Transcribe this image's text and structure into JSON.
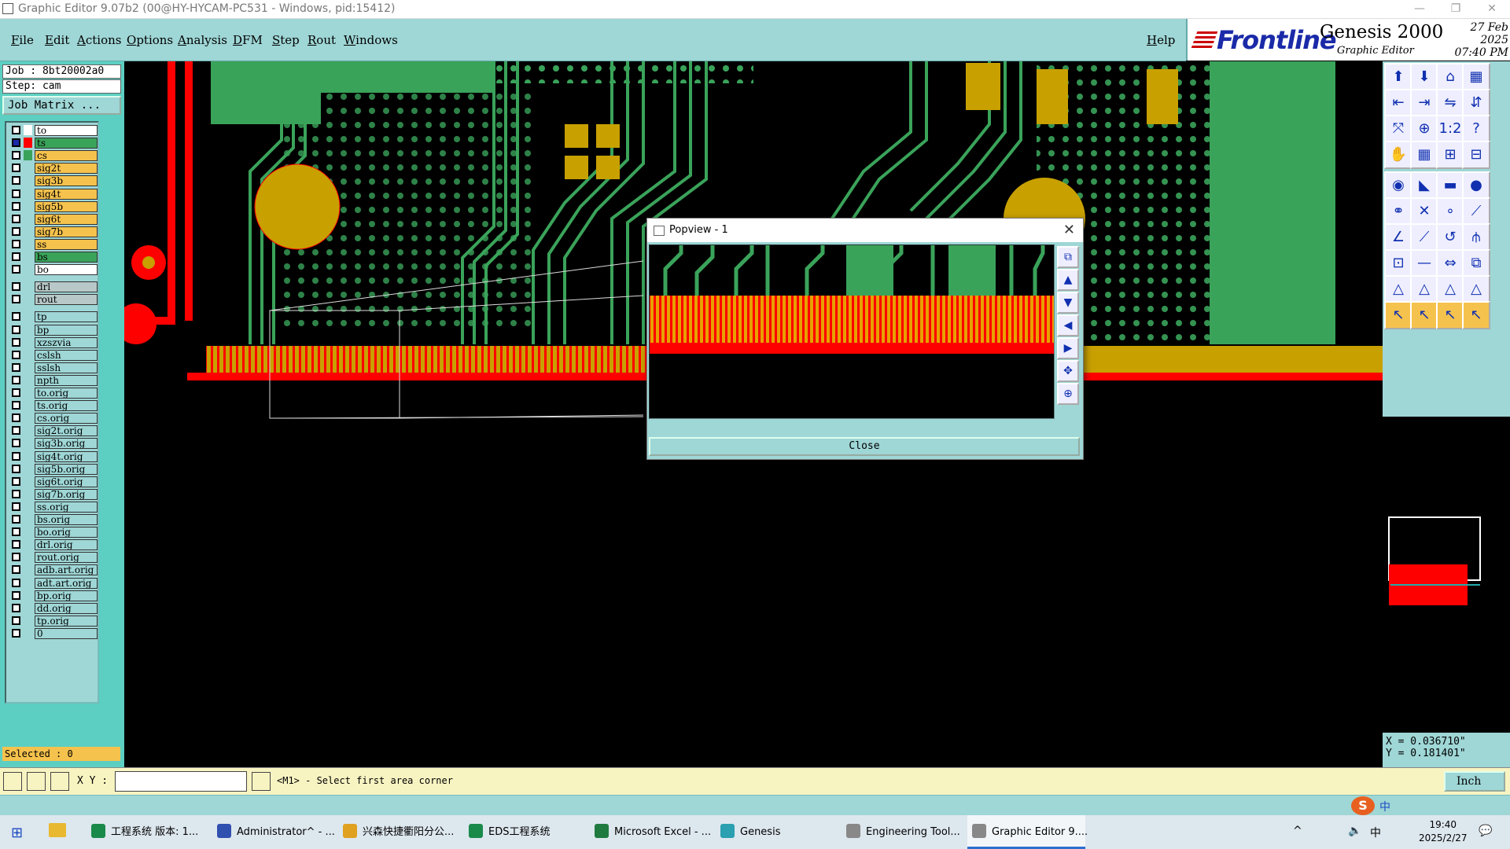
{
  "window": {
    "title": "Graphic Editor 9.07b2 (00@HY-HYCAM-PC531 - Windows, pid:15412)"
  },
  "menu": [
    "File",
    "Edit",
    "Actions",
    "Options",
    "Analysis",
    "DFM",
    "Step",
    "Rout",
    "Windows"
  ],
  "help_label": "Help",
  "brand": {
    "logo": "Frontline",
    "product": "Genesis 2000",
    "subtitle": "Graphic Editor",
    "date": "27 Feb 2025",
    "time": "07:40 PM"
  },
  "job": {
    "job_line": "Job : 8bt20002a0",
    "step_line": "Step: cam",
    "matrix_button": "Job Matrix ..."
  },
  "layers": [
    {
      "name": "to",
      "bg": "#ffffff",
      "swatch": "#ffffff",
      "sel": false
    },
    {
      "name": "ts",
      "bg": "#3aa35a",
      "swatch": "#ff0000",
      "sel": true
    },
    {
      "name": "cs",
      "bg": "#f5c24d",
      "swatch": "#3aa35a",
      "sel": false
    },
    {
      "name": "sig2t",
      "bg": "#f5c24d",
      "swatch": "#9fd6d6",
      "sel": false
    },
    {
      "name": "sig3b",
      "bg": "#f5c24d",
      "swatch": "#9fd6d6",
      "sel": false
    },
    {
      "name": "sig4t",
      "bg": "#f5c24d",
      "swatch": "#9fd6d6",
      "sel": false
    },
    {
      "name": "sig5b",
      "bg": "#f5c24d",
      "swatch": "#9fd6d6",
      "sel": false
    },
    {
      "name": "sig6t",
      "bg": "#f5c24d",
      "swatch": "#9fd6d6",
      "sel": false
    },
    {
      "name": "sig7b",
      "bg": "#f5c24d",
      "swatch": "#9fd6d6",
      "sel": false
    },
    {
      "name": "ss",
      "bg": "#f5c24d",
      "swatch": "#9fd6d6",
      "sel": false
    },
    {
      "name": "bs",
      "bg": "#3aa35a",
      "swatch": "#9fd6d6",
      "sel": false
    },
    {
      "name": "bo",
      "bg": "#ffffff",
      "swatch": "#9fd6d6",
      "sel": false
    },
    {
      "name": "drl",
      "bg": "#b8c8c8",
      "swatch": "#9fd6d6",
      "sel": false
    },
    {
      "name": "rout",
      "bg": "#b8c8c8",
      "swatch": "#9fd6d6",
      "sel": false
    },
    {
      "name": "tp",
      "bg": "#9fd6d6",
      "swatch": "#9fd6d6",
      "sel": false
    },
    {
      "name": "bp",
      "bg": "#9fd6d6",
      "swatch": "#9fd6d6",
      "sel": false
    },
    {
      "name": "xzszvia",
      "bg": "#9fd6d6",
      "swatch": "#9fd6d6",
      "sel": false
    },
    {
      "name": "cslsh",
      "bg": "#9fd6d6",
      "swatch": "#9fd6d6",
      "sel": false
    },
    {
      "name": "sslsh",
      "bg": "#9fd6d6",
      "swatch": "#9fd6d6",
      "sel": false
    },
    {
      "name": "npth",
      "bg": "#9fd6d6",
      "swatch": "#9fd6d6",
      "sel": false
    },
    {
      "name": "to.orig",
      "bg": "#9fd6d6",
      "swatch": "#9fd6d6",
      "sel": false
    },
    {
      "name": "ts.orig",
      "bg": "#9fd6d6",
      "swatch": "#9fd6d6",
      "sel": false
    },
    {
      "name": "cs.orig",
      "bg": "#9fd6d6",
      "swatch": "#9fd6d6",
      "sel": false
    },
    {
      "name": "sig2t.orig",
      "bg": "#9fd6d6",
      "swatch": "#9fd6d6",
      "sel": false
    },
    {
      "name": "sig3b.orig",
      "bg": "#9fd6d6",
      "swatch": "#9fd6d6",
      "sel": false
    },
    {
      "name": "sig4t.orig",
      "bg": "#9fd6d6",
      "swatch": "#9fd6d6",
      "sel": false
    },
    {
      "name": "sig5b.orig",
      "bg": "#9fd6d6",
      "swatch": "#9fd6d6",
      "sel": false
    },
    {
      "name": "sig6t.orig",
      "bg": "#9fd6d6",
      "swatch": "#9fd6d6",
      "sel": false
    },
    {
      "name": "sig7b.orig",
      "bg": "#9fd6d6",
      "swatch": "#9fd6d6",
      "sel": false
    },
    {
      "name": "ss.orig",
      "bg": "#9fd6d6",
      "swatch": "#9fd6d6",
      "sel": false
    },
    {
      "name": "bs.orig",
      "bg": "#9fd6d6",
      "swatch": "#9fd6d6",
      "sel": false
    },
    {
      "name": "bo.orig",
      "bg": "#9fd6d6",
      "swatch": "#9fd6d6",
      "sel": false
    },
    {
      "name": "drl.orig",
      "bg": "#9fd6d6",
      "swatch": "#9fd6d6",
      "sel": false
    },
    {
      "name": "rout.orig",
      "bg": "#9fd6d6",
      "swatch": "#9fd6d6",
      "sel": false
    },
    {
      "name": "adb.art.orig",
      "bg": "#9fd6d6",
      "swatch": "#9fd6d6",
      "sel": false
    },
    {
      "name": "adt.art.orig",
      "bg": "#9fd6d6",
      "swatch": "#9fd6d6",
      "sel": false
    },
    {
      "name": "bp.orig",
      "bg": "#9fd6d6",
      "swatch": "#9fd6d6",
      "sel": false
    },
    {
      "name": "dd.orig",
      "bg": "#9fd6d6",
      "swatch": "#9fd6d6",
      "sel": false
    },
    {
      "name": "tp.orig",
      "bg": "#9fd6d6",
      "swatch": "#9fd6d6",
      "sel": false
    },
    {
      "name": "0",
      "bg": "#9fd6d6",
      "swatch": "#9fd6d6",
      "sel": false
    }
  ],
  "selected_label": "Selected : 0",
  "popview": {
    "title": "Popview - 1",
    "close_label": "Close"
  },
  "coords": {
    "x": "X = 0.036710\"",
    "y": "Y = 0.181401\""
  },
  "status": {
    "xy_label": "X Y :",
    "message": "<M1> - Select first area corner",
    "unit": "Inch"
  },
  "taskbar": [
    {
      "label": "工程系统  版本: 1...",
      "color": "#1a8a4a"
    },
    {
      "label": "Administrator^ - ...",
      "color": "#3050b0"
    },
    {
      "label": "兴森快捷衢阳分公...",
      "color": "#e0a020"
    },
    {
      "label": "EDS工程系统",
      "color": "#1a8a4a"
    },
    {
      "label": "Microsoft Excel - ...",
      "color": "#1f7a3f"
    },
    {
      "label": "Genesis",
      "color": "#2aa0b0"
    },
    {
      "label": "Engineering Tool...",
      "color": "#888888"
    },
    {
      "label": "Graphic Editor 9....",
      "color": "#888888"
    }
  ],
  "tray": {
    "ime": "中",
    "time": "19:40",
    "date": "2025/2/27"
  },
  "colors": {
    "red": "#ff0000",
    "green": "#3aa35a",
    "gold": "#c8a000",
    "cyan": "#9fd6d6"
  },
  "tool_icons": [
    "arrow-up",
    "arrow-down",
    "home",
    "layout",
    "left",
    "right",
    "flip-h",
    "flip-v",
    "fit",
    "zoom-in",
    "ratio",
    "help",
    "pan",
    "grid",
    "snap-a",
    "snap-b",
    "select-pad",
    "measure",
    "ruler",
    "circle",
    "connect",
    "cross",
    "node",
    "edge",
    "line-a",
    "line-b",
    "arc",
    "graph",
    "add-pad",
    "minus",
    "resize",
    "move",
    "tri-a",
    "tri-b",
    "tri-c",
    "tri-d",
    "pointer",
    "pointer-b",
    "pointer-c",
    "pointer-d"
  ]
}
